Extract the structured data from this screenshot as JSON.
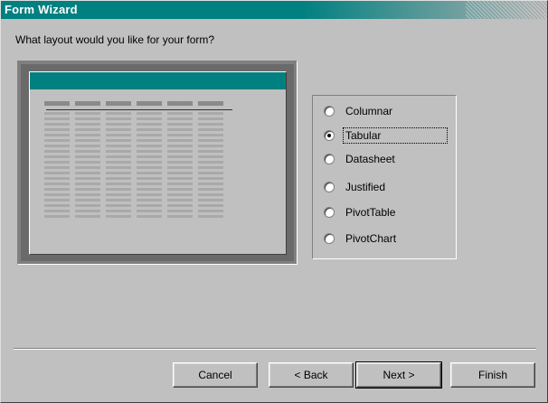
{
  "window": {
    "title": "Form Wizard"
  },
  "prompt": "What layout would you like for your form?",
  "layouts": [
    {
      "label": "Columnar",
      "selected": false,
      "focused": false
    },
    {
      "label": "Tabular",
      "selected": true,
      "focused": true
    },
    {
      "label": "Datasheet",
      "selected": false,
      "focused": false
    },
    {
      "label": "Justified",
      "selected": false,
      "focused": false
    },
    {
      "label": "PivotTable",
      "selected": false,
      "focused": false
    },
    {
      "label": "PivotChart",
      "selected": false,
      "focused": false
    }
  ],
  "buttons": {
    "cancel": "Cancel",
    "back": "< Back",
    "next": "Next >",
    "finish": "Finish"
  },
  "colors": {
    "titlebar": "#008080",
    "preview_header": "#008080",
    "face": "#c0c0c0"
  }
}
